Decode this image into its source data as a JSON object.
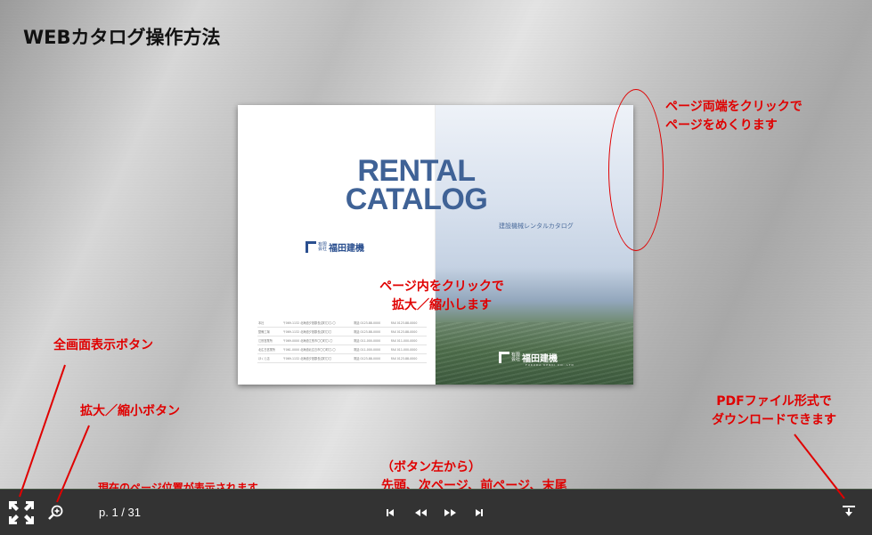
{
  "title": "WEBカタログ操作方法",
  "notes": {
    "flip_line1": "ページ両端をクリックで",
    "flip_line2": "ページをめくります",
    "zoom_page_line1": "ページ内をクリックで",
    "zoom_page_line2": "拡大／縮小します",
    "fullscreen": "全画面表示ボタン",
    "zoom_button": "拡大／縮小ボタン",
    "page_position": "現在のページ位置が表示されます",
    "nav_line1": "（ボタン左から）",
    "nav_line2": "先頭、次ページ、前ページ、末尾",
    "pdf_line1": "PDFファイル形式で",
    "pdf_line2": "ダウンロードできます"
  },
  "catalog": {
    "rental_line1": "RENTAL",
    "rental_line2": "CATALOG",
    "subtitle": "建設機械レンタルカタログ",
    "company_small1": "有限",
    "company_small2": "会社",
    "company_name": "福田建機",
    "company_en": "FUKUDA KENKI CO.,LTD",
    "offices": [
      [
        "本社",
        "〒069-1132 北海道夕張郡長沼町〇〇-〇",
        "電話 0123-88-0000",
        "FAX 0123-88-0000"
      ],
      [
        "整備工場",
        "〒069-1132 北海道夕張郡長沼町〇〇",
        "電話 0123-88-0000",
        "FAX 0123-88-0000"
      ],
      [
        "江別営業所",
        "〒069-0000 北海道江別市〇〇町〇-〇",
        "電話 011-000-0000",
        "FAX 011-000-0000"
      ],
      [
        "北広島営業所",
        "〒061-0000 北海道北広島市〇〇町〇-〇",
        "電話 011-000-0000",
        "FAX 011-000-0000"
      ],
      [
        "ほくと店",
        "〒069-1132 北海道夕張郡長沼町〇〇",
        "電話 0123-88-0000",
        "FAX 0123-88-0000"
      ]
    ]
  },
  "toolbar": {
    "page_indicator": "p. 1 / 31"
  },
  "colors": {
    "annotation": "#e00000",
    "toolbar": "#333333",
    "catalog_blue": "#3f6296"
  }
}
